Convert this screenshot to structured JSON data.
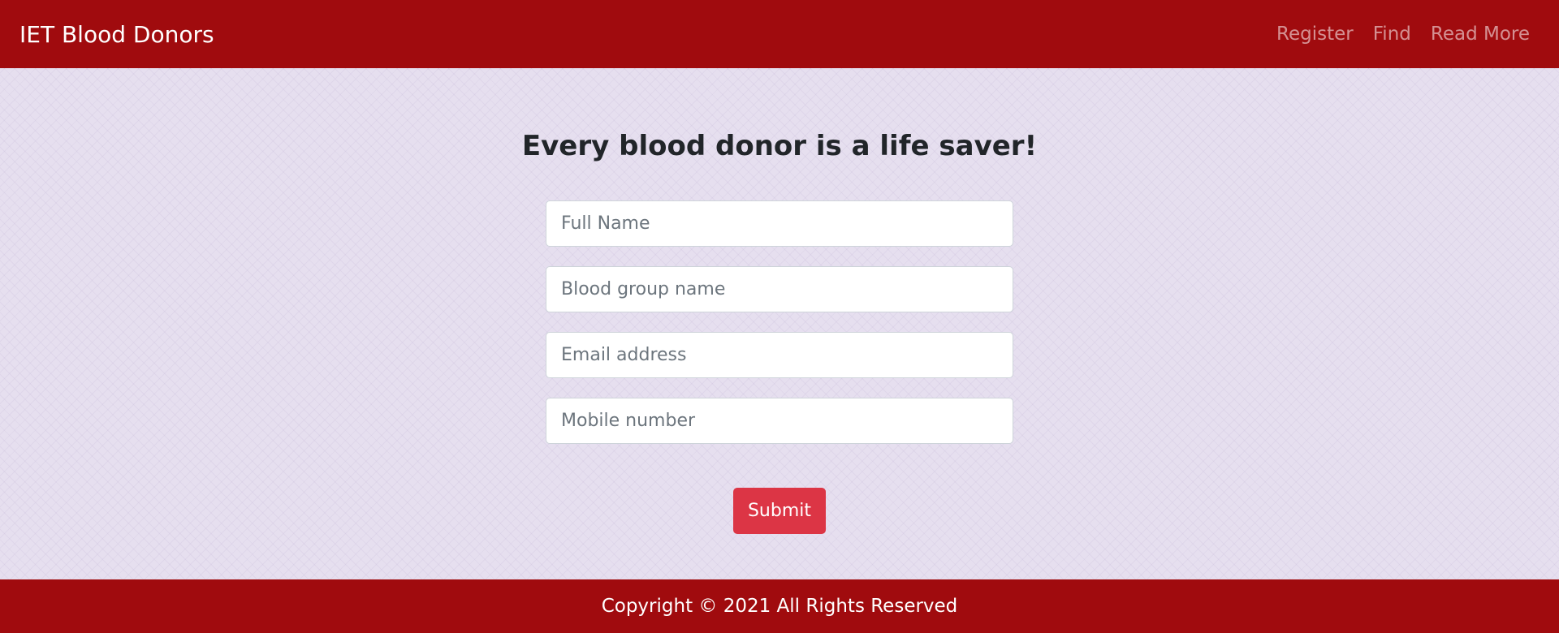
{
  "navbar": {
    "brand": "IET Blood Donors",
    "links": [
      "Register",
      "Find",
      "Read More"
    ]
  },
  "main": {
    "headline": "Every blood donor is a life saver!",
    "fields": {
      "full_name_placeholder": "Full Name",
      "blood_group_placeholder": "Blood group name",
      "email_placeholder": "Email address",
      "mobile_placeholder": "Mobile number"
    },
    "submit_label": "Submit"
  },
  "footer": {
    "copyright": "Copyright © 2021 All Rights Reserved"
  },
  "colors": {
    "brand_red": "#a00b0e",
    "button_red": "#dc3545",
    "page_background": "#e6dfef"
  }
}
